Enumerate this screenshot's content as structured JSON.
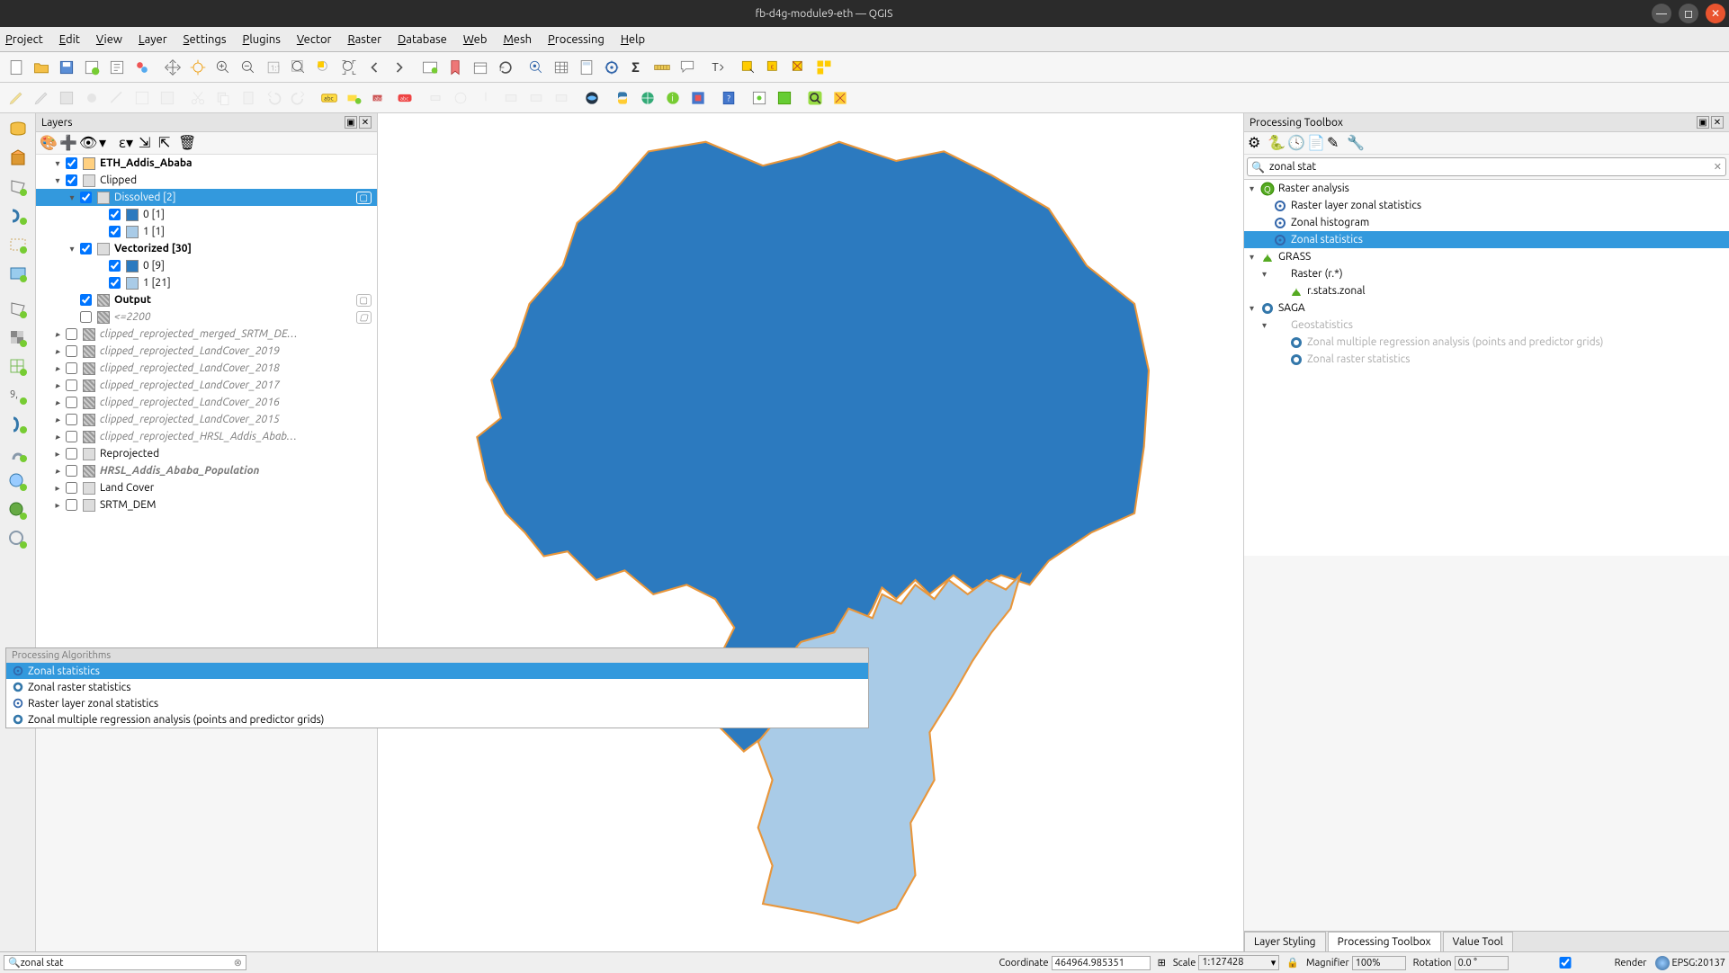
{
  "window": {
    "title": "fb-d4g-module9-eth — QGIS"
  },
  "menu": [
    "Project",
    "Edit",
    "View",
    "Layer",
    "Settings",
    "Plugins",
    "Vector",
    "Raster",
    "Database",
    "Web",
    "Mesh",
    "Processing",
    "Help"
  ],
  "layers_panel": {
    "title": "Layers",
    "items": [
      {
        "type": "row",
        "indent": 1,
        "expand": "▾",
        "checked": true,
        "swatch": "#ffd080",
        "name": "ETH_Addis_Ababa",
        "bold": true
      },
      {
        "type": "row",
        "indent": 1,
        "expand": "▾",
        "checked": true,
        "icon": "group",
        "name": "Clipped"
      },
      {
        "type": "row",
        "indent": 2,
        "expand": "▾",
        "checked": true,
        "icon": "group",
        "name": "Dissolved [2]",
        "selected": true,
        "rcount": "▢"
      },
      {
        "type": "row",
        "indent": 4,
        "expand": "",
        "checked": true,
        "swatch": "#2c7abf",
        "name": "0 [1]"
      },
      {
        "type": "row",
        "indent": 4,
        "expand": "",
        "checked": true,
        "swatch": "#a9cbe7",
        "name": "1 [1]"
      },
      {
        "type": "row",
        "indent": 2,
        "expand": "▾",
        "checked": true,
        "icon": "group",
        "name": "Vectorized [30]",
        "bold": true
      },
      {
        "type": "row",
        "indent": 4,
        "expand": "",
        "checked": true,
        "swatch": "#2c7abf",
        "name": "0 [9]"
      },
      {
        "type": "row",
        "indent": 4,
        "expand": "",
        "checked": true,
        "swatch": "#a9cbe7",
        "name": "1 [21]"
      },
      {
        "type": "row",
        "indent": 2,
        "expand": "",
        "checked": true,
        "icon": "raster",
        "name": "Output",
        "bold": true,
        "rcount": "▢"
      },
      {
        "type": "row",
        "indent": 2,
        "expand": "",
        "checked": false,
        "icon": "raster",
        "name": "<=2200",
        "rcount": "▢",
        "italic": true
      },
      {
        "type": "row",
        "indent": 1,
        "expand": "▸",
        "checked": false,
        "icon": "raster",
        "name": "clipped_reprojected_merged_SRTM_DE…",
        "italic": true
      },
      {
        "type": "row",
        "indent": 1,
        "expand": "▸",
        "checked": false,
        "icon": "raster",
        "name": "clipped_reprojected_LandCover_2019",
        "italic": true
      },
      {
        "type": "row",
        "indent": 1,
        "expand": "▸",
        "checked": false,
        "icon": "raster",
        "name": "clipped_reprojected_LandCover_2018",
        "italic": true
      },
      {
        "type": "row",
        "indent": 1,
        "expand": "▸",
        "checked": false,
        "icon": "raster",
        "name": "clipped_reprojected_LandCover_2017",
        "italic": true
      },
      {
        "type": "row",
        "indent": 1,
        "expand": "▸",
        "checked": false,
        "icon": "raster",
        "name": "clipped_reprojected_LandCover_2016",
        "italic": true
      },
      {
        "type": "row",
        "indent": 1,
        "expand": "▸",
        "checked": false,
        "icon": "raster",
        "name": "clipped_reprojected_LandCover_2015",
        "italic": true
      },
      {
        "type": "row",
        "indent": 1,
        "expand": "▸",
        "checked": false,
        "icon": "raster",
        "name": "clipped_reprojected_HRSL_Addis_Abab…",
        "italic": true
      },
      {
        "type": "row",
        "indent": 1,
        "expand": "▸",
        "checked": false,
        "icon": "group",
        "name": "Reprojected"
      },
      {
        "type": "row",
        "indent": 1,
        "expand": "▸",
        "checked": false,
        "icon": "raster",
        "name": "HRSL_Addis_Ababa_Population",
        "italic": true,
        "bold": true
      },
      {
        "type": "row",
        "indent": 1,
        "expand": "▸",
        "checked": false,
        "icon": "group",
        "name": "Land Cover"
      },
      {
        "type": "row",
        "indent": 1,
        "expand": "▸",
        "checked": false,
        "icon": "group",
        "name": "SRTM_DEM"
      }
    ]
  },
  "locator_popup": {
    "header": "Processing Algorithms",
    "items": [
      {
        "label": "Zonal statistics",
        "selected": true,
        "icon": "gear-blue"
      },
      {
        "label": "Zonal raster statistics",
        "icon": "saga"
      },
      {
        "label": "Raster layer zonal statistics",
        "icon": "gear-blue"
      },
      {
        "label": "Zonal multiple regression analysis (points and predictor grids)",
        "icon": "saga"
      }
    ]
  },
  "processing_panel": {
    "title": "Processing Toolbox",
    "search": "zonal stat",
    "tree": [
      {
        "indent": 0,
        "expand": "▾",
        "icon": "qgis",
        "label": "Raster analysis"
      },
      {
        "indent": 1,
        "expand": "",
        "icon": "gear-blue",
        "label": "Raster layer zonal statistics"
      },
      {
        "indent": 1,
        "expand": "",
        "icon": "gear-blue",
        "label": "Zonal histogram"
      },
      {
        "indent": 1,
        "expand": "",
        "icon": "gear-blue",
        "label": "Zonal statistics",
        "selected": true
      },
      {
        "indent": 0,
        "expand": "▾",
        "icon": "grass",
        "label": "GRASS"
      },
      {
        "indent": 1,
        "expand": "▾",
        "icon": "",
        "label": "Raster (r.*)"
      },
      {
        "indent": 2,
        "expand": "",
        "icon": "grass",
        "label": "r.stats.zonal"
      },
      {
        "indent": 0,
        "expand": "▾",
        "icon": "saga",
        "label": "SAGA"
      },
      {
        "indent": 1,
        "expand": "▾",
        "icon": "",
        "label": "Geostatistics",
        "faded": true
      },
      {
        "indent": 2,
        "expand": "",
        "icon": "saga",
        "label": "Zonal multiple regression analysis (points and predictor grids)",
        "faded": true
      },
      {
        "indent": 2,
        "expand": "",
        "icon": "saga",
        "label": "Zonal raster statistics",
        "faded": true
      }
    ]
  },
  "tabs": [
    "Layer Styling",
    "Processing Toolbox",
    "Value Tool"
  ],
  "active_tab": "Processing Toolbox",
  "statusbar": {
    "locator_value": "zonal stat",
    "coordinate_label": "Coordinate",
    "coordinate": "464964.985351",
    "scale_label": "Scale",
    "scale": "1:127428",
    "magnifier_label": "Magnifier",
    "magnifier": "100%",
    "rotation_label": "Rotation",
    "rotation": "0.0 °",
    "render_label": "Render",
    "epsg": "EPSG:20137"
  }
}
